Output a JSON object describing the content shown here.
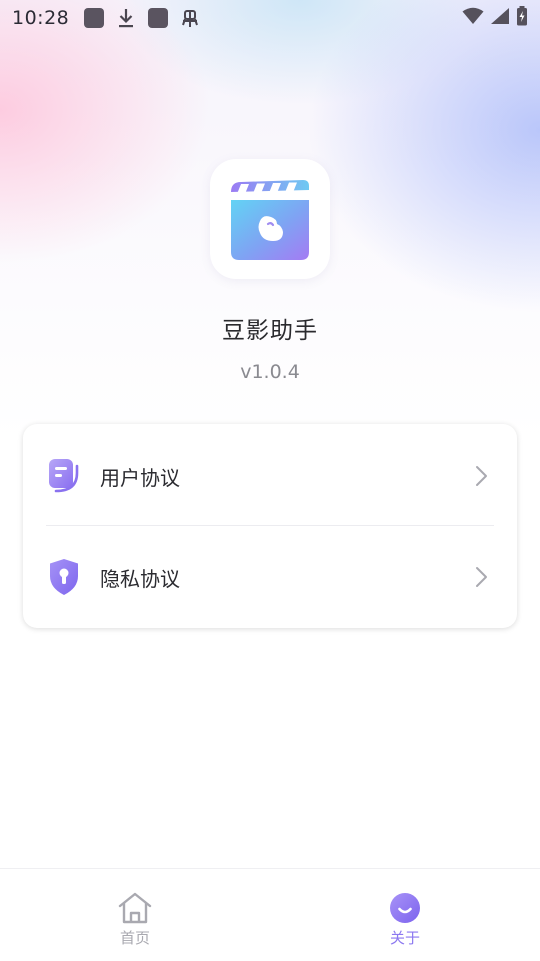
{
  "status_bar": {
    "time": "10:28",
    "left_icons": [
      "app-square-icon",
      "download-icon",
      "app-square-icon",
      "bug-icon"
    ],
    "right_icons": [
      "wifi-icon",
      "signal-icon",
      "battery-charging-icon"
    ]
  },
  "app": {
    "name": "豆影助手",
    "version": "v1.0.4",
    "logo_icon": "clapperboard-bean-icon"
  },
  "menu": {
    "items": [
      {
        "label": "用户协议",
        "icon": "document-icon"
      },
      {
        "label": "隐私协议",
        "icon": "shield-icon"
      }
    ]
  },
  "tabbar": {
    "tabs": [
      {
        "label": "首页",
        "icon": "home-icon",
        "active": false
      },
      {
        "label": "关于",
        "icon": "smile-icon",
        "active": true
      }
    ]
  },
  "colors": {
    "accent": "#8c78f0",
    "inactive": "#a9a9b0",
    "text": "#2b2b30",
    "subtext": "#8a8a90"
  }
}
